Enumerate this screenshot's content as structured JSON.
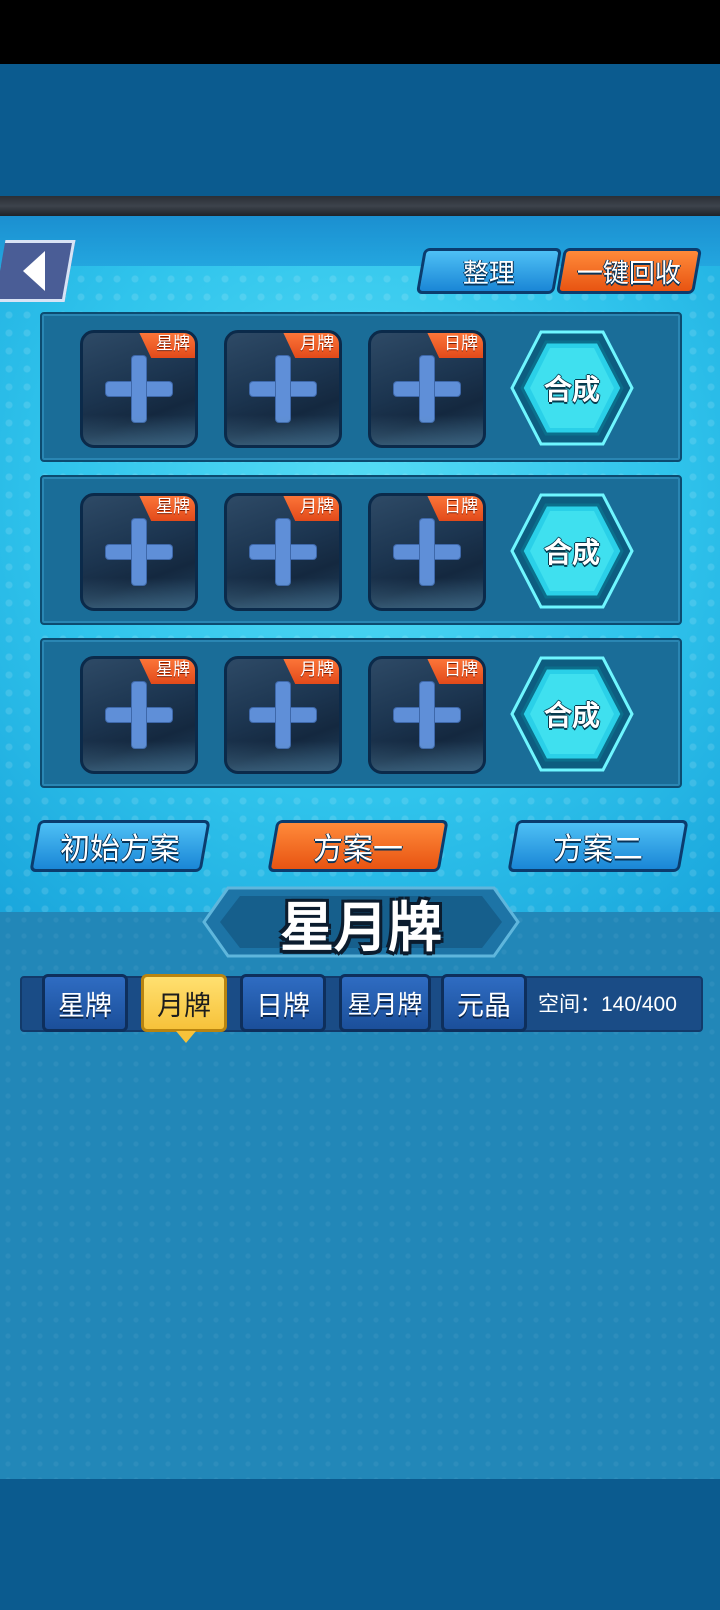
{
  "header": {
    "back_label": "",
    "sort_label": "整理",
    "recycle_label": "一键回收"
  },
  "rows": [
    {
      "slots": [
        "星牌",
        "月牌",
        "日牌"
      ],
      "synth_label": "合成"
    },
    {
      "slots": [
        "星牌",
        "月牌",
        "日牌"
      ],
      "synth_label": "合成"
    },
    {
      "slots": [
        "星牌",
        "月牌",
        "日牌"
      ],
      "synth_label": "合成"
    }
  ],
  "plans": [
    "初始方案",
    "方案一",
    "方案二"
  ],
  "selected_plan": "方案一",
  "section_title": "星月牌",
  "tabs": [
    "星牌",
    "月牌",
    "日牌",
    "星月牌",
    "元晶"
  ],
  "selected_tab": "月牌",
  "space": "空间：140/400",
  "colors": {
    "accent_orange": "#e85412",
    "accent_blue": "#1a86d6",
    "tab_active": "#f7c23a"
  }
}
